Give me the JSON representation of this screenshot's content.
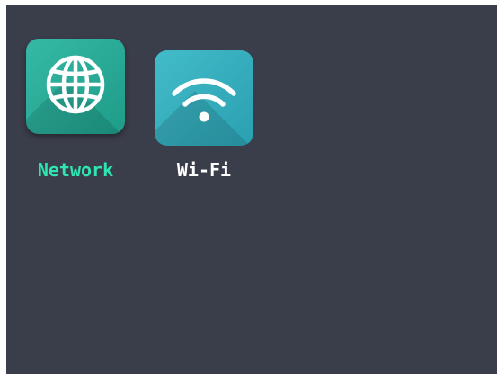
{
  "menu": {
    "items": [
      {
        "label": "Network",
        "icon": "globe-icon",
        "selected": true
      },
      {
        "label": "Wi-Fi",
        "icon": "wifi-icon",
        "selected": false
      }
    ]
  },
  "colors": {
    "background": "#3a3d4a",
    "network_tile": "#2aac98",
    "wifi_tile": "#38afbe",
    "selected_label": "#2ee6b0",
    "label": "#ffffff"
  }
}
